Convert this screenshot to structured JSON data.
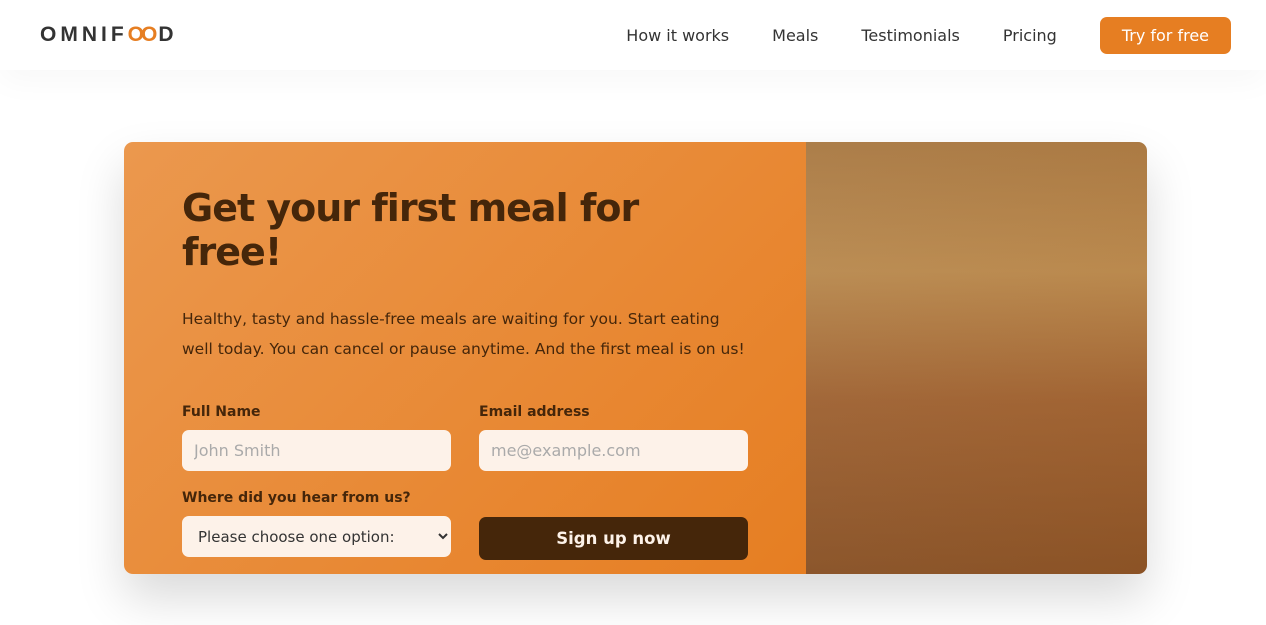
{
  "header": {
    "logo": "OMNIFOOD",
    "nav": [
      "How it works",
      "Meals",
      "Testimonials",
      "Pricing"
    ],
    "cta": "Try for free"
  },
  "cta_section": {
    "title": "Get your first meal for free!",
    "description": "Healthy, tasty and hassle-free meals are waiting for you. Start eating well today. You can cancel or pause anytime. And the first meal is on us!",
    "full_name_label": "Full Name",
    "full_name_placeholder": "John Smith",
    "email_label": "Email address",
    "email_placeholder": "me@example.com",
    "source_label": "Where did you hear from us?",
    "source_selected": "Please choose one option:",
    "submit": "Sign up now"
  },
  "colors": {
    "primary": "#e67e22",
    "dark": "#45260a",
    "input_bg": "#fdf2e9"
  }
}
